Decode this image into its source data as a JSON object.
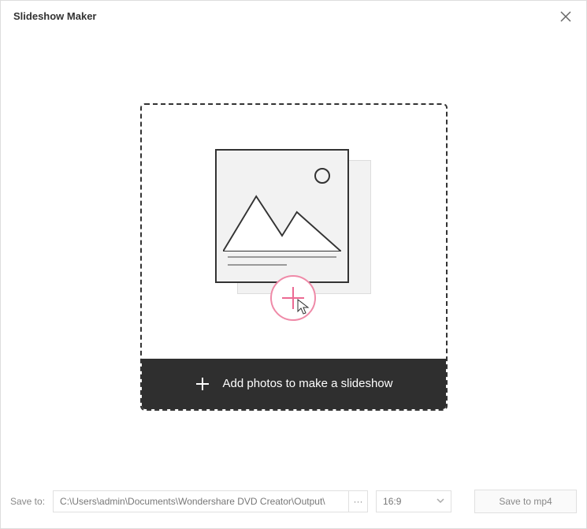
{
  "window": {
    "title": "Slideshow Maker"
  },
  "dropzone": {
    "add_label": "Add photos to make a slideshow"
  },
  "footer": {
    "save_to_label": "Save to:",
    "path_value": "C:\\Users\\admin\\Documents\\Wondershare DVD Creator\\Output\\",
    "browse_label": "···",
    "aspect_ratio_selected": "16:9",
    "save_button_label": "Save to mp4"
  }
}
